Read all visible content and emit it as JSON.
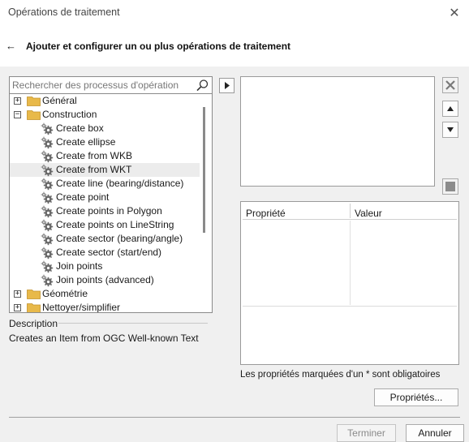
{
  "window": {
    "title": "Opérations de traitement"
  },
  "header": {
    "title": "Ajouter et configurer un ou plus opérations de traitement"
  },
  "search": {
    "placeholder": "Rechercher des processus d'opération"
  },
  "tree": {
    "items": [
      {
        "label": "Général",
        "type": "folder",
        "expander": "+",
        "level": 0
      },
      {
        "label": "Construction",
        "type": "folder",
        "expander": "−",
        "level": 0
      },
      {
        "label": "Create box",
        "type": "process",
        "level": 1
      },
      {
        "label": "Create ellipse",
        "type": "process",
        "level": 1
      },
      {
        "label": "Create from WKB",
        "type": "process",
        "level": 1
      },
      {
        "label": "Create from WKT",
        "type": "process",
        "level": 1,
        "selected": true
      },
      {
        "label": "Create line (bearing/distance)",
        "type": "process",
        "level": 1
      },
      {
        "label": "Create point",
        "type": "process",
        "level": 1
      },
      {
        "label": "Create points in Polygon",
        "type": "process",
        "level": 1
      },
      {
        "label": "Create points on LineString",
        "type": "process",
        "level": 1
      },
      {
        "label": "Create sector (bearing/angle)",
        "type": "process",
        "level": 1
      },
      {
        "label": "Create sector (start/end)",
        "type": "process",
        "level": 1
      },
      {
        "label": "Join points",
        "type": "process",
        "level": 1
      },
      {
        "label": "Join points (advanced)",
        "type": "process",
        "level": 1
      },
      {
        "label": "Géométrie",
        "type": "folder",
        "expander": "+",
        "level": 0
      },
      {
        "label": "Nettoyer/simplifier",
        "type": "folder",
        "expander": "+",
        "level": 0
      }
    ]
  },
  "description": {
    "title": "Description",
    "text": "Creates an Item from OGC Well-known Text"
  },
  "properties": {
    "columns": [
      "Propriété",
      "Valeur"
    ],
    "mandatory_note": "Les propriétés marquées d'un * sont obligatoires",
    "button": "Propriétés..."
  },
  "footer": {
    "finish": "Terminer",
    "cancel": "Annuler"
  },
  "colors": {
    "highlight": "#20e616",
    "folder": "#e8b94a",
    "window_bg": "#f0f0f0"
  },
  "icons": {
    "back": "arrow-left-icon",
    "close": "close-icon",
    "search": "search-icon",
    "add": "chevron-right-icon",
    "delete": "delete-icon",
    "up": "arrow-up-icon",
    "down": "arrow-down-icon",
    "folder": "folder-icon",
    "process": "gear-icon"
  }
}
